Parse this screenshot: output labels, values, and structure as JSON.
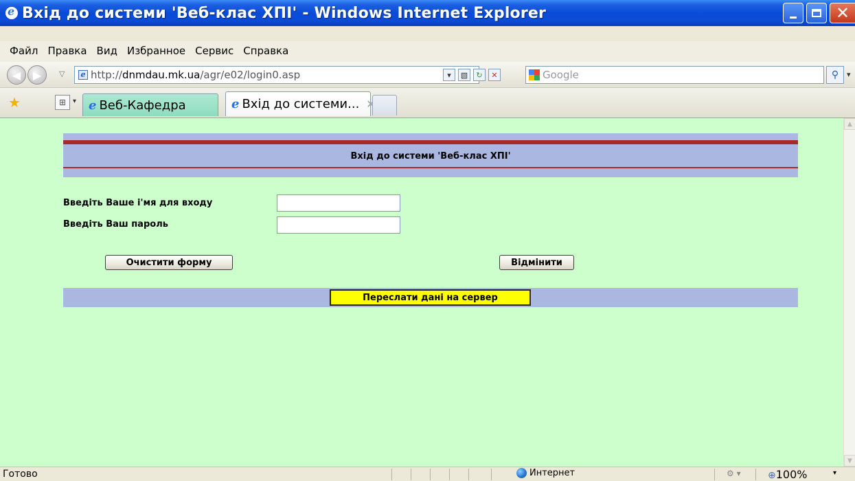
{
  "window": {
    "title": "Вхід до системи 'Веб-клас ХПІ' - Windows Internet Explorer"
  },
  "menu": {
    "items": [
      "Файл",
      "Правка",
      "Вид",
      "Избранное",
      "Сервис",
      "Справка"
    ]
  },
  "address": {
    "url_prefix": "http://",
    "url_host": "dnmdau.mk.ua",
    "url_path": "/agr/e02/login0.asp",
    "search_placeholder": "Google"
  },
  "tabs": [
    {
      "label": "Веб-Кафедра",
      "active": false
    },
    {
      "label": "Вхід до системи...",
      "active": true
    }
  ],
  "page": {
    "background": "#ccffcc",
    "banner_color": "#aab7e0",
    "rule_color": "#a52a2a",
    "banner_title": "Вхід до системи 'Веб-клас ХПІ'",
    "login_label": "Введіть Ваше і'мя для входу",
    "password_label": "Введіть Ваш пароль",
    "login_value": "",
    "password_value": "",
    "clear_button": "Очистити форму",
    "cancel_button": "Відмінити",
    "submit_button": "Переслати дані на сервер",
    "submit_color": "#ffff00"
  },
  "status": {
    "text": "Готово",
    "zone": "Интернет",
    "zoom": "100%"
  },
  "icons": {
    "app": "ie-logo-icon",
    "back": "back-arrow-icon",
    "forward": "forward-arrow-icon",
    "refresh": "refresh-icon",
    "stop": "stop-icon",
    "search": "search-magnifier-icon",
    "favorites": "star-icon",
    "quicktabs": "quick-tabs-icon",
    "zone": "globe-icon",
    "zoom": "zoom-icon"
  }
}
